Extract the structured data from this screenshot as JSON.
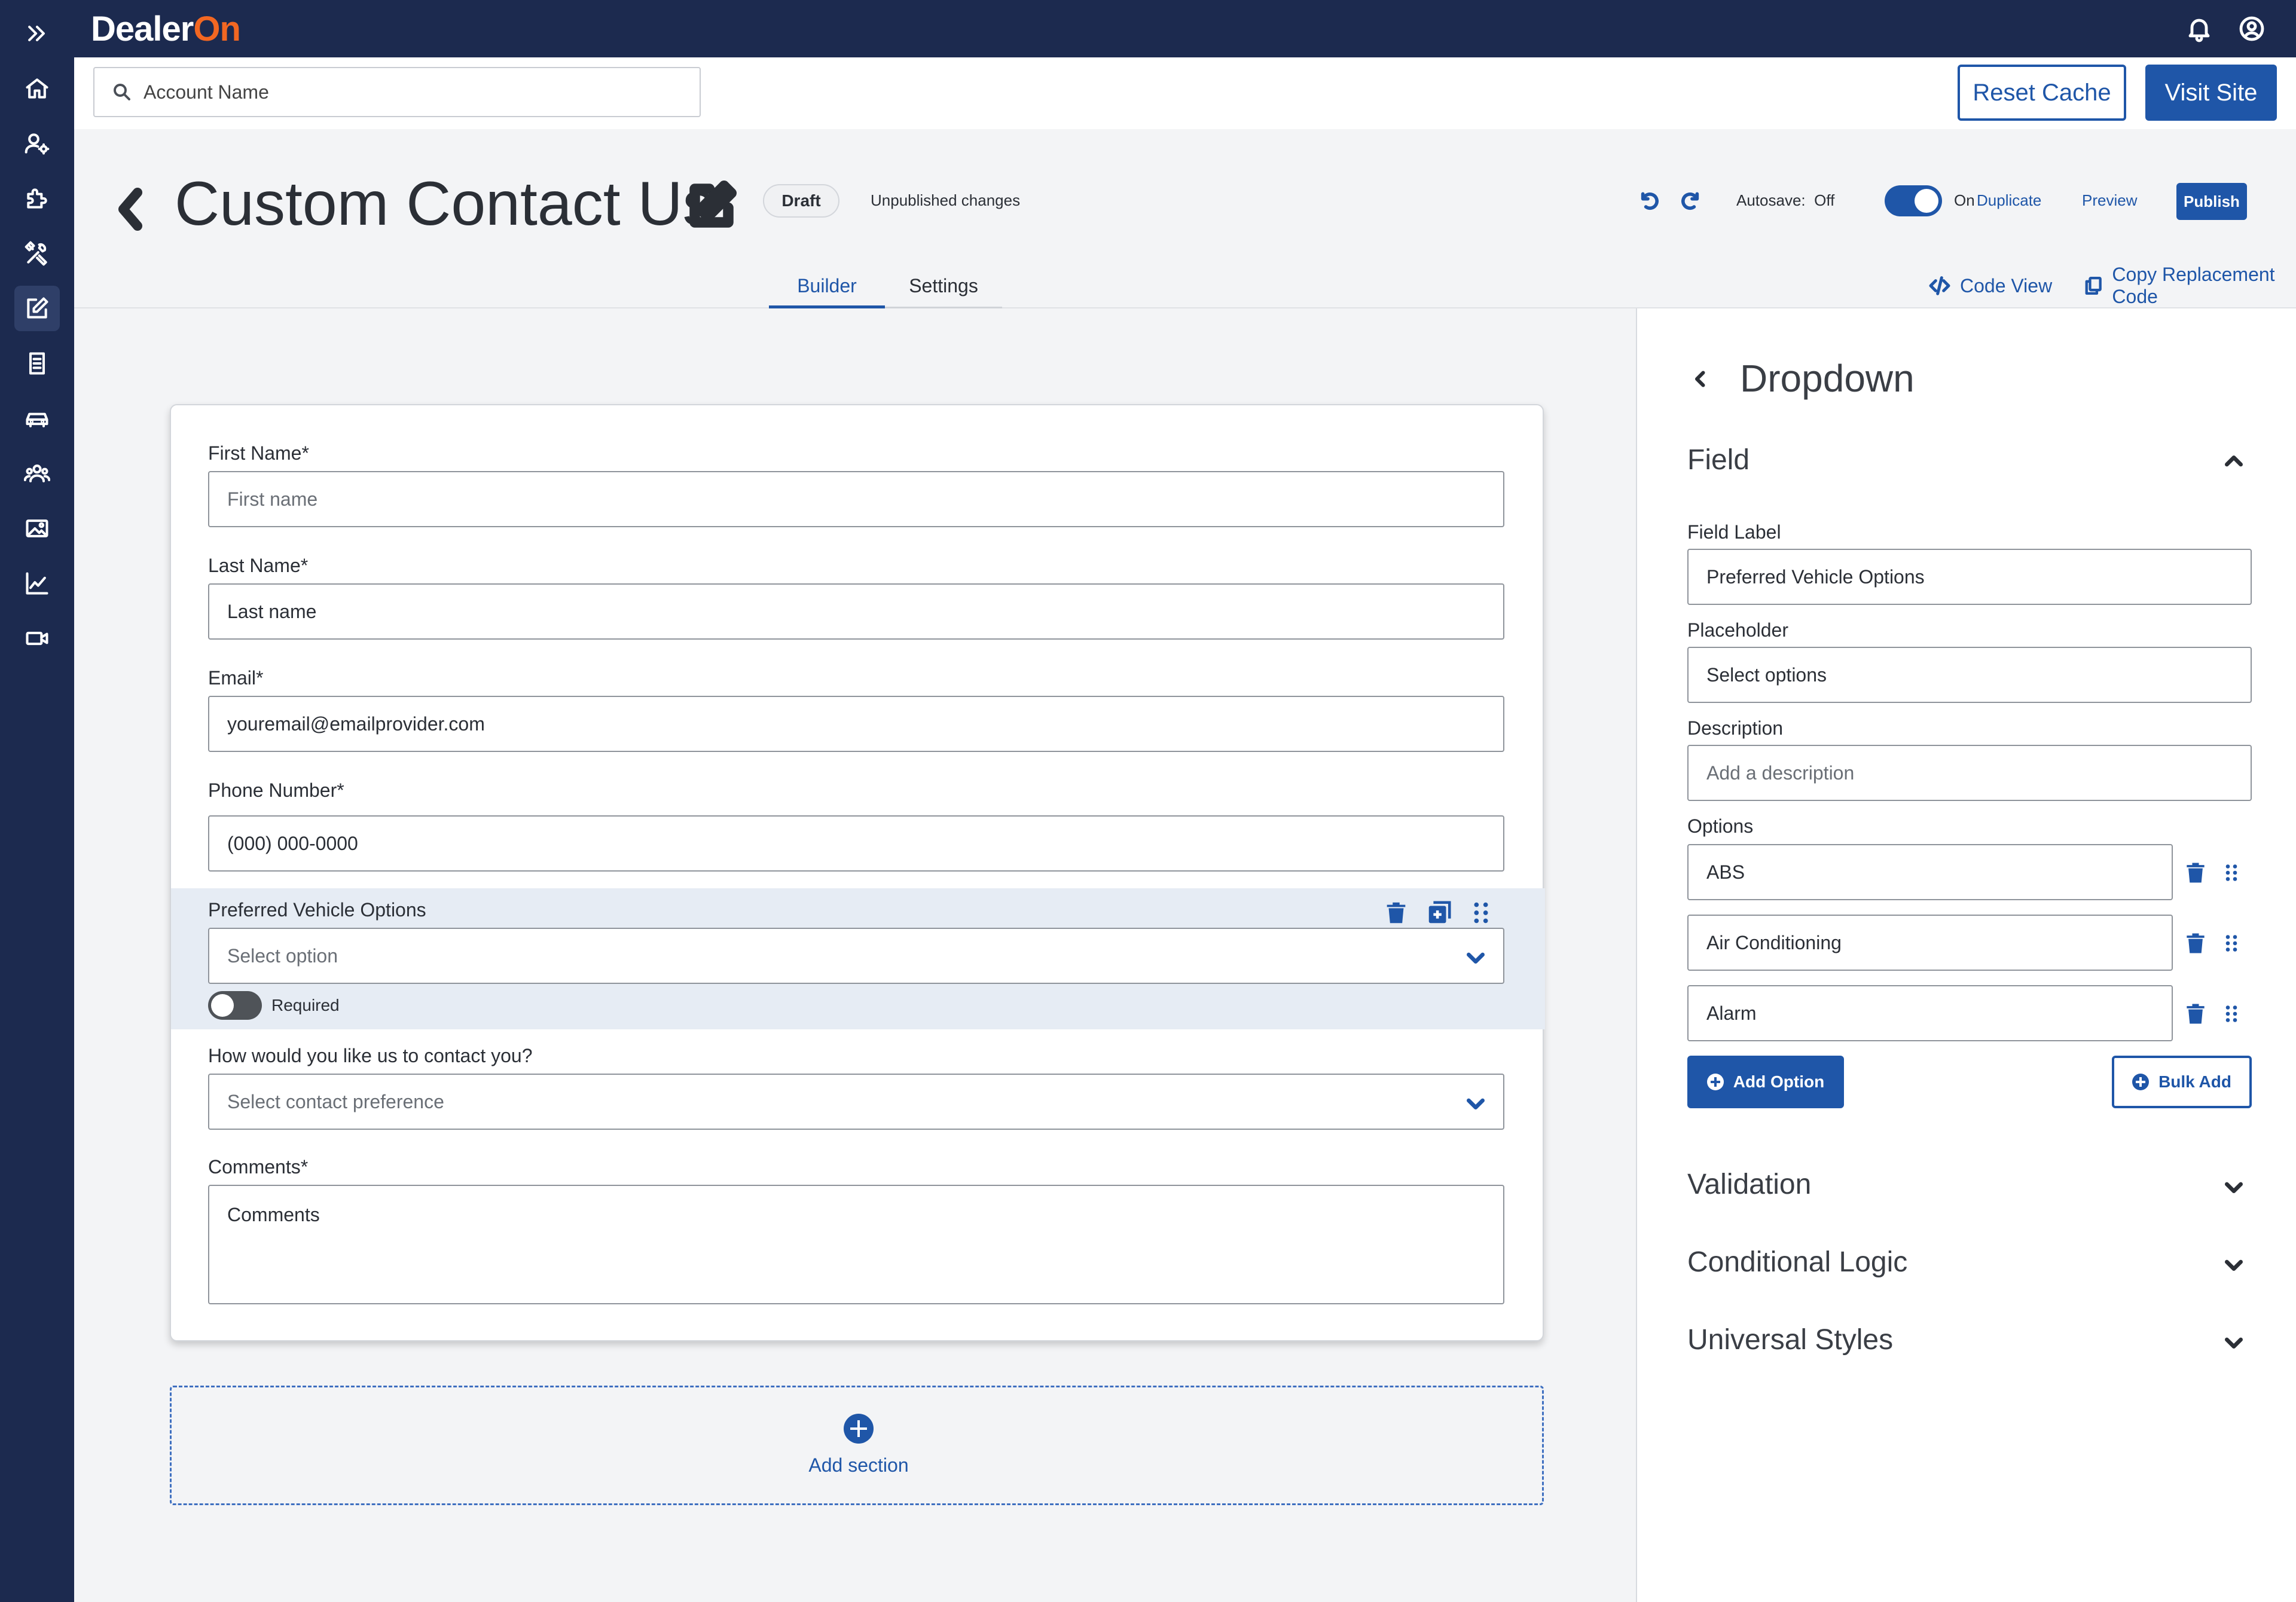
{
  "brand": {
    "name_part1": "Dealer",
    "name_part2": "On",
    "accent": "#f26722",
    "primary": "#1f56a8",
    "sidebar_bg": "#1c2a4f"
  },
  "sidebar": {
    "items": [
      {
        "icon": "double-chevron-right-icon"
      },
      {
        "icon": "home-icon"
      },
      {
        "icon": "user-settings-icon"
      },
      {
        "icon": "puzzle-icon"
      },
      {
        "icon": "tools-icon"
      },
      {
        "icon": "edit-icon",
        "active": true
      },
      {
        "icon": "receipt-icon"
      },
      {
        "icon": "car-icon"
      },
      {
        "icon": "users-icon"
      },
      {
        "icon": "image-icon"
      },
      {
        "icon": "chart-icon"
      },
      {
        "icon": "video-icon"
      }
    ]
  },
  "topbar": {
    "icons": [
      "bell-icon",
      "account-circle-icon"
    ]
  },
  "subbar": {
    "search_placeholder": "Account Name",
    "reset_cache": "Reset Cache",
    "visit_site": "Visit Site"
  },
  "header": {
    "title": "Custom Contact Us",
    "status": "Draft",
    "status_note": "Unpublished changes",
    "autosave_label": "Autosave:",
    "autosave_off": "Off",
    "autosave_on": "On",
    "autosave_enabled": true,
    "duplicate": "Duplicate",
    "preview": "Preview",
    "publish": "Publish",
    "tabs": [
      {
        "label": "Builder",
        "active": true
      },
      {
        "label": "Settings",
        "active": false
      }
    ],
    "code_view": "Code View",
    "copy_code": "Copy Replacement Code"
  },
  "form": {
    "fields": [
      {
        "label": "First Name*",
        "value": "First name",
        "is_placeholder": true
      },
      {
        "label": "Last Name*",
        "value": "Last name",
        "is_placeholder": false
      },
      {
        "label": "Email*",
        "value": "youremail@emailprovider.com",
        "is_placeholder": false
      },
      {
        "label": "Phone Number*",
        "value": "(000) 000-0000",
        "is_placeholder": false
      },
      {
        "label": "Preferred Vehicle Options",
        "value": "Select option",
        "is_placeholder": true,
        "type": "dropdown",
        "selected": true,
        "required_label": "Required",
        "required": false
      },
      {
        "label": "How would you like us to contact you?",
        "value": "Select contact preference",
        "is_placeholder": true,
        "type": "dropdown"
      },
      {
        "label": "Comments*",
        "value": "Comments",
        "type": "textarea"
      }
    ],
    "add_section": "Add section"
  },
  "panel": {
    "title": "Dropdown",
    "field_section": "Field",
    "field_label_label": "Field Label",
    "field_label_value": "Preferred Vehicle Options",
    "placeholder_label": "Placeholder",
    "placeholder_value": "Select options",
    "description_label": "Description",
    "description_placeholder": "Add a description",
    "options_label": "Options",
    "options": [
      "ABS",
      "Air Conditioning",
      "Alarm"
    ],
    "add_option": "Add Option",
    "bulk_add": "Bulk Add",
    "sections": [
      "Validation",
      "Conditional Logic",
      "Universal Styles"
    ]
  }
}
